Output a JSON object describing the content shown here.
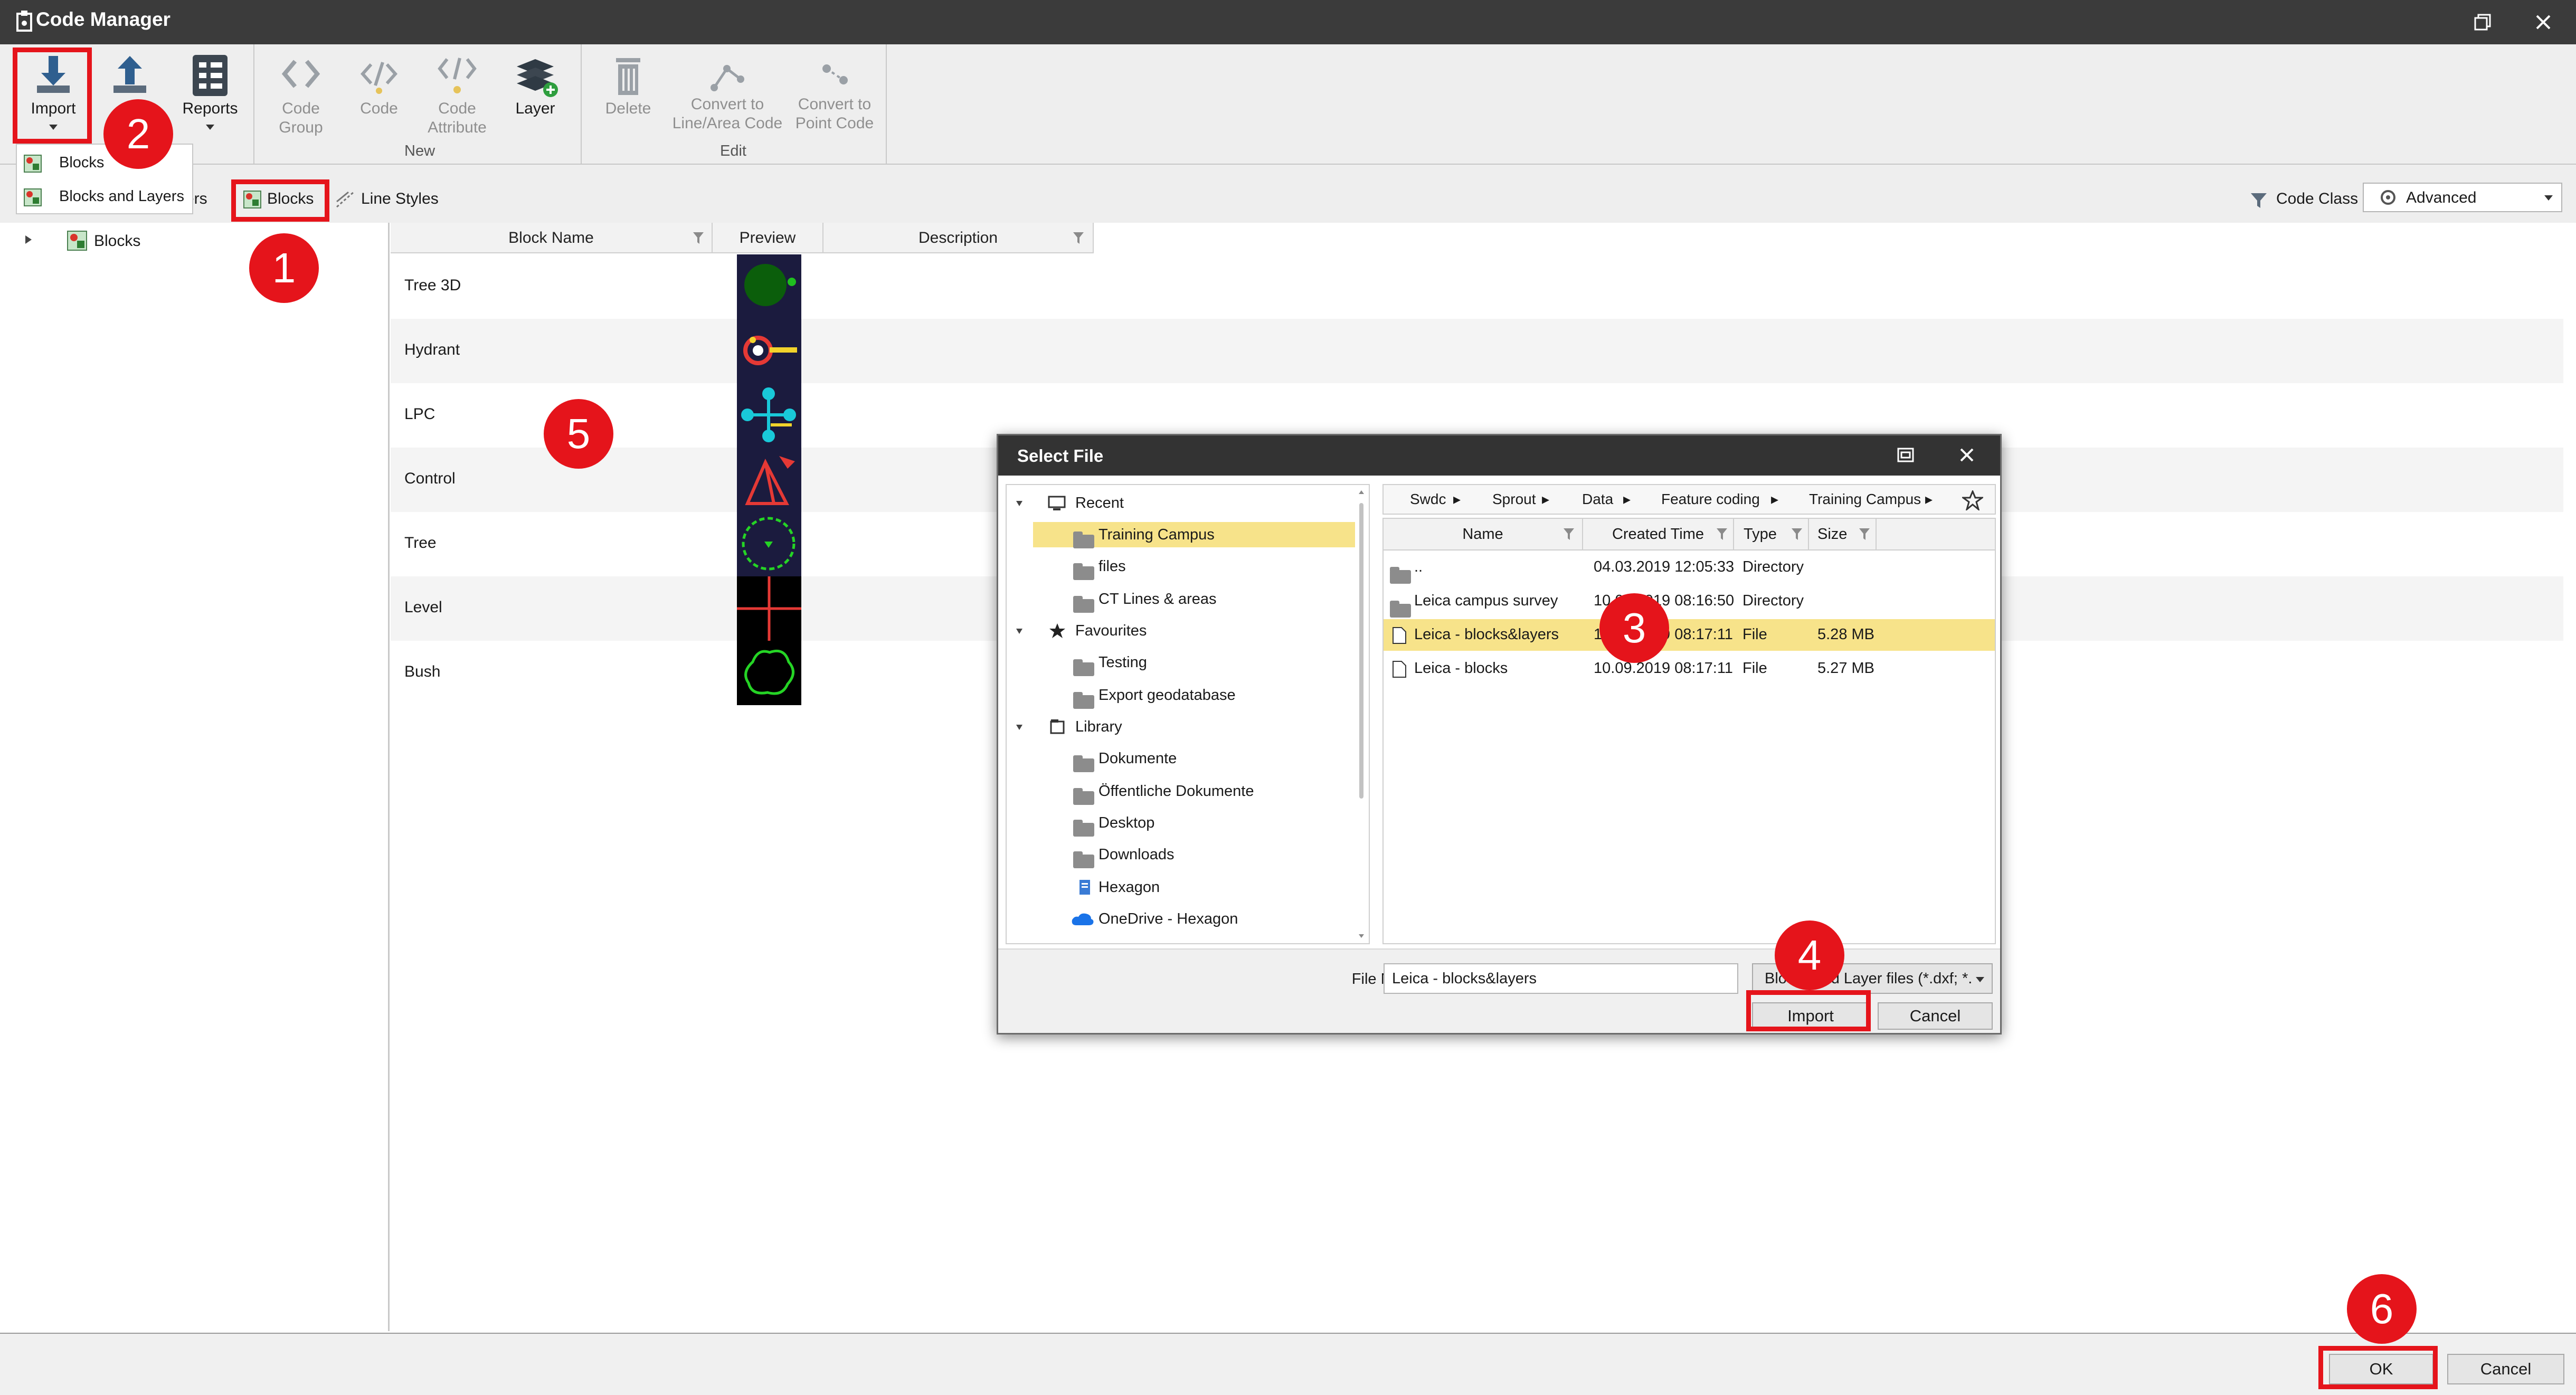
{
  "window": {
    "title": "Code Manager"
  },
  "ribbon": {
    "import": "Import",
    "export": "E",
    "reports": "Reports",
    "code_group": "Code Group",
    "code": "Code",
    "code_attribute": "Code Attribute",
    "layer": "Layer",
    "group_new": "New",
    "delete": "Delete",
    "convert_line": "Convert to Line/Area Code",
    "convert_point": "Convert to Point Code",
    "group_edit": "Edit"
  },
  "import_menu": [
    "Blocks",
    "Blocks and Layers"
  ],
  "tabs": {
    "layers_partial": "yers",
    "blocks": "Blocks",
    "line_styles": "Line Styles"
  },
  "code_class": {
    "label": "Code Class",
    "value": "Advanced"
  },
  "tree": {
    "root": "Blocks"
  },
  "grid": {
    "columns": [
      "Block Name",
      "Preview",
      "Description"
    ],
    "rows": [
      {
        "name": "Tree 3D"
      },
      {
        "name": "Hydrant"
      },
      {
        "name": "LPC"
      },
      {
        "name": "Control"
      },
      {
        "name": "Tree"
      },
      {
        "name": "Level"
      },
      {
        "name": "Bush"
      }
    ]
  },
  "dialog": {
    "title": "Select File",
    "tree": [
      {
        "label": "Recent",
        "level": 0
      },
      {
        "label": "Training Campus",
        "level": 1,
        "selected": true
      },
      {
        "label": "files",
        "level": 1
      },
      {
        "label": "CT Lines & areas",
        "level": 1
      },
      {
        "label": "Favourites",
        "level": 0
      },
      {
        "label": "Testing",
        "level": 1
      },
      {
        "label": "Export geodatabase",
        "level": 1
      },
      {
        "label": "Library",
        "level": 0
      },
      {
        "label": "Dokumente",
        "level": 1
      },
      {
        "label": "Öffentliche Dokumente",
        "level": 1
      },
      {
        "label": "Desktop",
        "level": 1
      },
      {
        "label": "Downloads",
        "level": 1
      },
      {
        "label": "Hexagon",
        "level": 1
      },
      {
        "label": "OneDrive - Hexagon",
        "level": 1
      }
    ],
    "breadcrumb": [
      "Swdc",
      "Sprout",
      "Data",
      "Feature coding",
      "Training Campus"
    ],
    "columns": [
      "Name",
      "Created Time",
      "Type",
      "Size"
    ],
    "files": [
      {
        "name": "..",
        "created": "04.03.2019 12:05:33",
        "type": "Directory",
        "size": ""
      },
      {
        "name": "Leica campus survey",
        "created": "10.09.2019 08:16:50",
        "type": "Directory",
        "size": ""
      },
      {
        "name": "Leica - blocks&layers",
        "created": "10.09.2019 08:17:11",
        "type": "File",
        "size": "5.28 MB",
        "selected": true
      },
      {
        "name": "Leica - blocks",
        "created": "10.09.2019 08:17:11",
        "type": "File",
        "size": "5.27 MB"
      }
    ],
    "file_name_label": "File Name:",
    "file_name_value": "Leica - blocks&layers",
    "file_type": "Blocks and Layer files (*.dxf; *.",
    "import_button": "Import",
    "cancel_button": "Cancel"
  },
  "footer": {
    "ok": "OK",
    "cancel": "Cancel"
  },
  "annotations": [
    "1",
    "2",
    "3",
    "4",
    "5",
    "6"
  ],
  "colors": {
    "accent_red": "#e5141b",
    "selection": "#f7e38a",
    "dark_title": "#333333",
    "preview_bg": "#1b1b3e"
  }
}
